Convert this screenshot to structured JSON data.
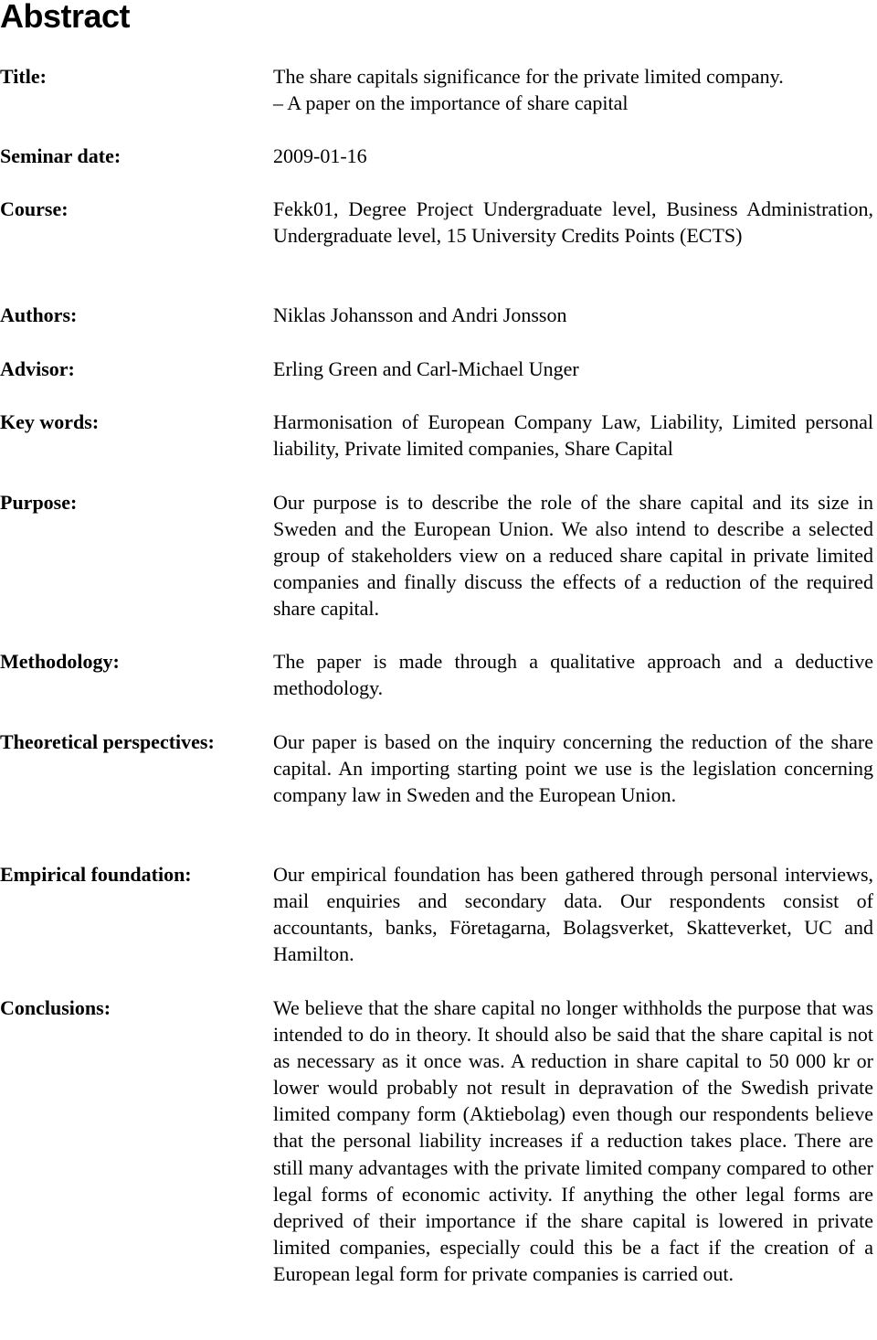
{
  "heading": "Abstract",
  "fields": {
    "title": {
      "label": "Title:",
      "line1": "The share capitals significance for the private limited company.",
      "line2": "– A paper on the importance of share capital"
    },
    "seminar_date": {
      "label": "Seminar date:",
      "value": "2009-01-16"
    },
    "course": {
      "label": "Course:",
      "value": "Fekk01, Degree Project Undergraduate level, Business Administration, Undergraduate level, 15 University Credits Points (ECTS)"
    },
    "authors": {
      "label": "Authors:",
      "value": "Niklas Johansson and Andri Jonsson"
    },
    "advisor": {
      "label": "Advisor:",
      "value": "Erling Green and Carl-Michael Unger"
    },
    "key_words": {
      "label": "Key words:",
      "value": "Harmonisation of European Company Law, Liability, Limited personal liability, Private limited companies, Share Capital"
    },
    "purpose": {
      "label": "Purpose:",
      "value": "Our purpose is to describe the role of the share capital and its size in Sweden and the European Union. We also intend to describe a selected group of stakeholders view on a reduced share capital in private limited companies and finally discuss the effects of a reduction of the required share capital."
    },
    "methodology": {
      "label": "Methodology:",
      "value": "The paper is made through a qualitative approach and a deductive methodology."
    },
    "theoretical_perspectives": {
      "label": "Theoretical perspectives:",
      "value": "Our paper is based on the inquiry concerning the reduction of the share capital. An importing starting point we use is the legislation concerning company law in Sweden and the European Union."
    },
    "empirical_foundation": {
      "label": "Empirical foundation:",
      "value": "Our empirical foundation has been gathered through personal interviews, mail enquiries and secondary data. Our respondents consist of accountants, banks, Företagarna, Bolagsverket, Skatteverket, UC and Hamilton."
    },
    "conclusions": {
      "label": "Conclusions:",
      "value": "We believe that the share capital no longer withholds the purpose that was intended to do in theory. It should also be said that the share capital is not as necessary as it once was. A reduction in share capital to 50 000 kr or lower would probably not result in depravation of the Swedish private limited company form (Aktiebolag) even though our respondents believe that the personal liability increases if a reduction takes place. There are still many advantages with the private limited company compared to other legal forms of economic activity. If anything the other legal forms are deprived of their importance if the share capital is lowered in private limited companies, especially could this be a fact if the creation of a European legal form for private companies is carried out."
    }
  }
}
